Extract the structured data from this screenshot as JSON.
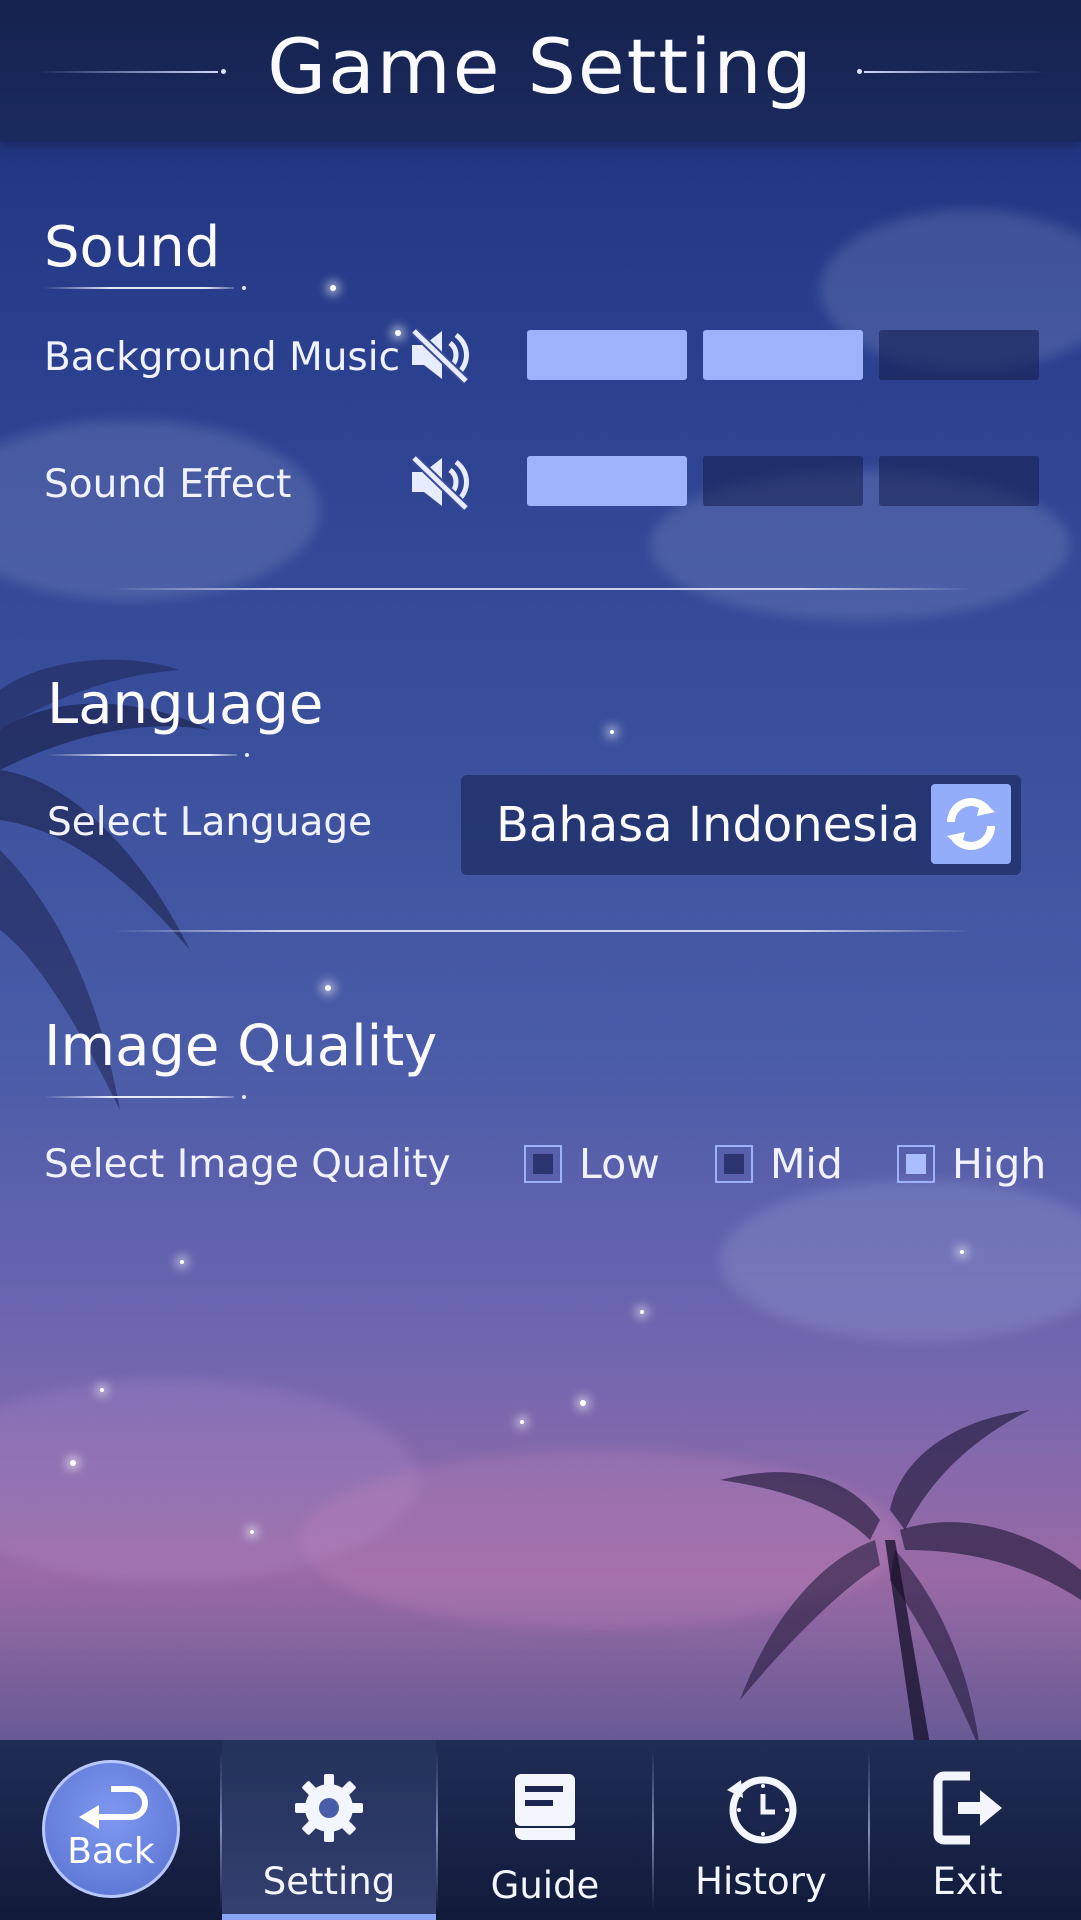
{
  "header": {
    "title": "Game Setting"
  },
  "sound": {
    "title": "Sound",
    "background_music": {
      "label": "Background Music",
      "muted": true,
      "level": 2,
      "max_level": 3
    },
    "sound_effect": {
      "label": "Sound Effect",
      "muted": true,
      "level": 1,
      "max_level": 3
    }
  },
  "language": {
    "title": "Language",
    "select_label": "Select Language",
    "current_value": "Bahasa Indonesia",
    "refresh_icon": "refresh-icon"
  },
  "image_quality": {
    "title": "Image Quality",
    "select_label": "Select Image Quality",
    "options": [
      {
        "label": "Low",
        "checked": false
      },
      {
        "label": "Mid",
        "checked": false
      },
      {
        "label": "High",
        "checked": true
      }
    ]
  },
  "bottom_nav": {
    "back_label": "Back",
    "items": [
      {
        "label": "Setting",
        "icon": "gear-icon",
        "active": true
      },
      {
        "label": "Guide",
        "icon": "book-icon",
        "active": false
      },
      {
        "label": "History",
        "icon": "clock-history-icon",
        "active": false
      },
      {
        "label": "Exit",
        "icon": "exit-icon",
        "active": false
      }
    ]
  },
  "colors": {
    "accent": "#9db2fb",
    "header_bg": "#1b2a5e",
    "slider_off": "#1e2a5c"
  }
}
